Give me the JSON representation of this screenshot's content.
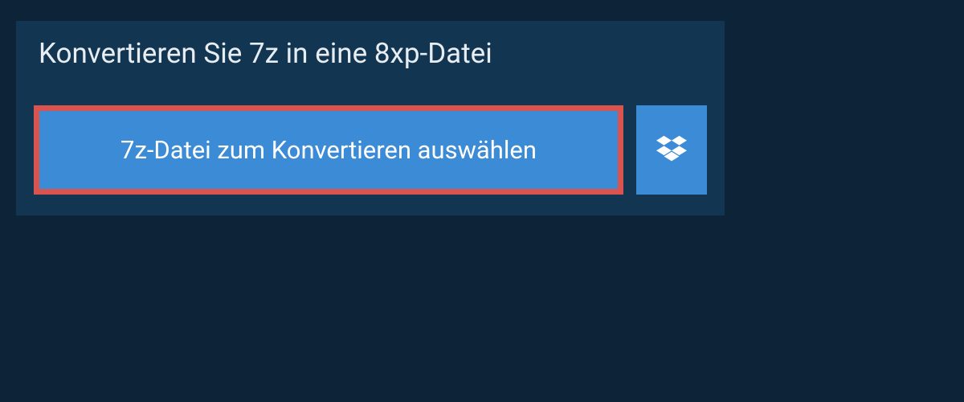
{
  "title": "Konvertieren Sie 7z in eine 8xp-Datei",
  "select_button_label": "7z-Datei zum Konvertieren auswählen",
  "colors": {
    "background": "#0d2438",
    "panel": "#123552",
    "button": "#3b8bd6",
    "highlight_border": "#d9534f",
    "text_light": "#e8edf2",
    "text_white": "#ffffff"
  }
}
